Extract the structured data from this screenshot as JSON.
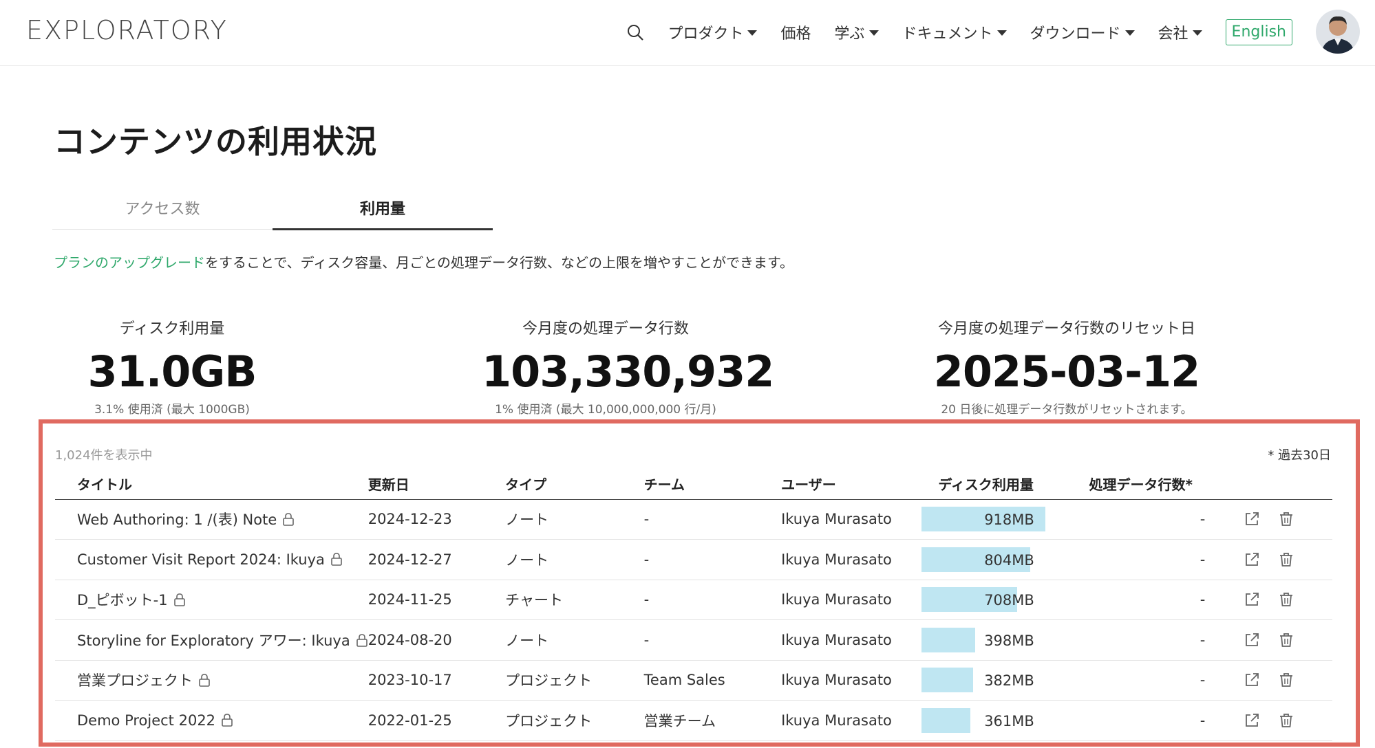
{
  "header": {
    "logo": "EXPLORATORY",
    "nav": [
      {
        "label": "プロダクト",
        "dropdown": true
      },
      {
        "label": "価格",
        "dropdown": false
      },
      {
        "label": "学ぶ",
        "dropdown": true
      },
      {
        "label": "ドキュメント",
        "dropdown": true
      },
      {
        "label": "ダウンロード",
        "dropdown": true
      },
      {
        "label": "会社",
        "dropdown": true
      }
    ],
    "language_button": "English"
  },
  "page": {
    "title": "コンテンツの利用状況",
    "tabs": [
      {
        "label": "アクセス数",
        "active": false
      },
      {
        "label": "利用量",
        "active": true
      }
    ],
    "notice_link": "プランのアップグレード",
    "notice_text": "をすることで、ディスク容量、月ごとの処理データ行数、などの上限を増やすことができます。"
  },
  "stats": [
    {
      "label": "ディスク利用量",
      "value": "31.0GB",
      "sub": "3.1% 使用済 (最大 1000GB)"
    },
    {
      "label": "今月度の処理データ行数",
      "value": "103,330,932",
      "sub": "1% 使用済 (最大 10,000,000,000 行/月)"
    },
    {
      "label": "今月度の処理データ行数のリセット日",
      "value": "2025-03-12",
      "sub": "20 日後に処理データ行数がリセットされます。"
    }
  ],
  "table": {
    "count_text": "1,024件を表示中",
    "period_note": "* 過去30日",
    "columns": [
      "タイトル",
      "更新日",
      "タイプ",
      "チーム",
      "ユーザー",
      "ディスク利用量",
      "処理データ行数*"
    ],
    "rows": [
      {
        "title": "Web Authoring: 1 /(表) Note",
        "date": "2024-12-23",
        "type": "ノート",
        "team": "-",
        "user": "Ikuya Murasato",
        "disk": "918MB",
        "disk_mb": 918,
        "rows": "-"
      },
      {
        "title": "Customer Visit Report 2024: Ikuya",
        "date": "2024-12-27",
        "type": "ノート",
        "team": "-",
        "user": "Ikuya Murasato",
        "disk": "804MB",
        "disk_mb": 804,
        "rows": "-"
      },
      {
        "title": "D_ピボット-1",
        "date": "2024-11-25",
        "type": "チャート",
        "team": "-",
        "user": "Ikuya Murasato",
        "disk": "708MB",
        "disk_mb": 708,
        "rows": "-"
      },
      {
        "title": "Storyline for Exploratory アワー: Ikuya",
        "date": "2024-08-20",
        "type": "ノート",
        "team": "-",
        "user": "Ikuya Murasato",
        "disk": "398MB",
        "disk_mb": 398,
        "rows": "-"
      },
      {
        "title": "営業プロジェクト",
        "date": "2023-10-17",
        "type": "プロジェクト",
        "team": "Team Sales",
        "user": "Ikuya Murasato",
        "disk": "382MB",
        "disk_mb": 382,
        "rows": "-"
      },
      {
        "title": "Demo Project 2022",
        "date": "2022-01-25",
        "type": "プロジェクト",
        "team": "営業チーム",
        "user": "Ikuya Murasato",
        "disk": "361MB",
        "disk_mb": 361,
        "rows": "-"
      }
    ]
  },
  "colors": {
    "accent_green": "#2fa86b",
    "highlight_border": "#e06a60",
    "disk_bar": "#bfe6f2"
  },
  "icons": [
    "search-icon",
    "caret-down-icon",
    "lock-icon",
    "external-link-icon",
    "trash-icon"
  ]
}
